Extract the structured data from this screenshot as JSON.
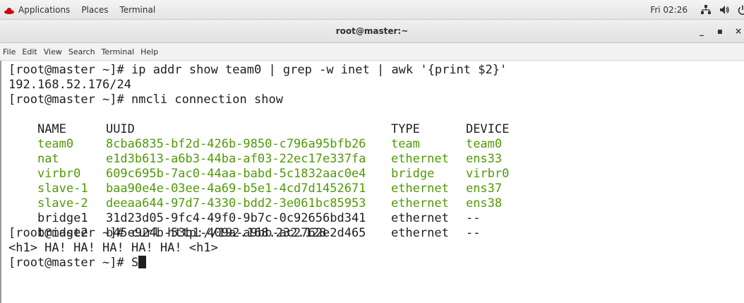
{
  "topbar": {
    "applications": "Applications",
    "places": "Places",
    "terminal": "Terminal",
    "clock": "Fri 02:26",
    "icons": [
      "network-icon",
      "volume-icon",
      "power-icon"
    ]
  },
  "window": {
    "title": "root@master:~",
    "minimize": "_",
    "maximize": "▪",
    "close": "×"
  },
  "menubar": {
    "items": [
      "File",
      "Edit",
      "View",
      "Search",
      "Terminal",
      "Help"
    ]
  },
  "terminal": {
    "line1": "[root@master ~]# ip addr show team0 | grep -w inet | awk '{print $2}'",
    "line2": "192.168.52.176/24",
    "line3": "[root@master ~]# nmcli connection show",
    "header": {
      "name": "NAME",
      "uuid": "UUID",
      "type": "TYPE",
      "device": "DEVICE"
    },
    "connections": [
      {
        "name": "team0",
        "uuid": "8cba6835-bf2d-426b-9850-c796a95bfb26",
        "type": "team",
        "device": "team0",
        "active": true
      },
      {
        "name": "nat",
        "uuid": "e1d3b613-a6b3-44ba-af03-22ec17e337fa",
        "type": "ethernet",
        "device": "ens33",
        "active": true
      },
      {
        "name": "virbr0",
        "uuid": "609c695b-7ac0-44aa-babd-5c1832aac0e4",
        "type": "bridge",
        "device": "virbr0",
        "active": true
      },
      {
        "name": "slave-1",
        "uuid": "baa90e4e-03ee-4a69-b5e1-4cd7d1452671",
        "type": "ethernet",
        "device": "ens37",
        "active": true
      },
      {
        "name": "slave-2",
        "uuid": "deeaa644-97d7-4330-bdd2-3e061bc85953",
        "type": "ethernet",
        "device": "ens38",
        "active": true
      },
      {
        "name": "bridge1",
        "uuid": "31d23d05-9fc4-49f0-9b7c-0c92656bd341",
        "type": "ethernet",
        "device": "--",
        "active": false
      },
      {
        "name": "bridge2",
        "uuid": "b45e924b-53b1-409a-a9bb-ac2762e2d465",
        "type": "ethernet",
        "device": "--",
        "active": false
      }
    ],
    "line_curl": "[root@master ~]# curl http://192.168.232.128",
    "line_output": "<h1> HA! HA! HA! HA! HA! <h1>",
    "prompt_current": "[root@master ~]# S"
  },
  "colors": {
    "active_connection": "#4f9a06",
    "text": "#1e1e1e"
  }
}
